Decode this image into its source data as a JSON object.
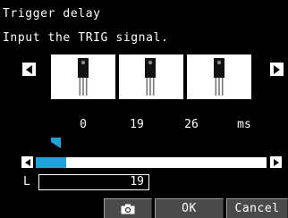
{
  "title": "Trigger delay",
  "instruction": "Input the TRIG signal.",
  "thumbnails": [
    {
      "icon": "transistor-image"
    },
    {
      "icon": "transistor-image"
    },
    {
      "icon": "transistor-image"
    }
  ],
  "times": [
    "0",
    "19",
    "26"
  ],
  "time_unit": "ms",
  "slider": {
    "value_fraction": 0.13
  },
  "value_field": {
    "label": "L",
    "value": "19"
  },
  "buttons": {
    "camera_icon": "camera-icon",
    "ok_label": "OK",
    "cancel_label": "Cancel"
  },
  "colors": {
    "accent": "#1fa3d8",
    "background": "#000000",
    "button": "#4a4a4a"
  }
}
